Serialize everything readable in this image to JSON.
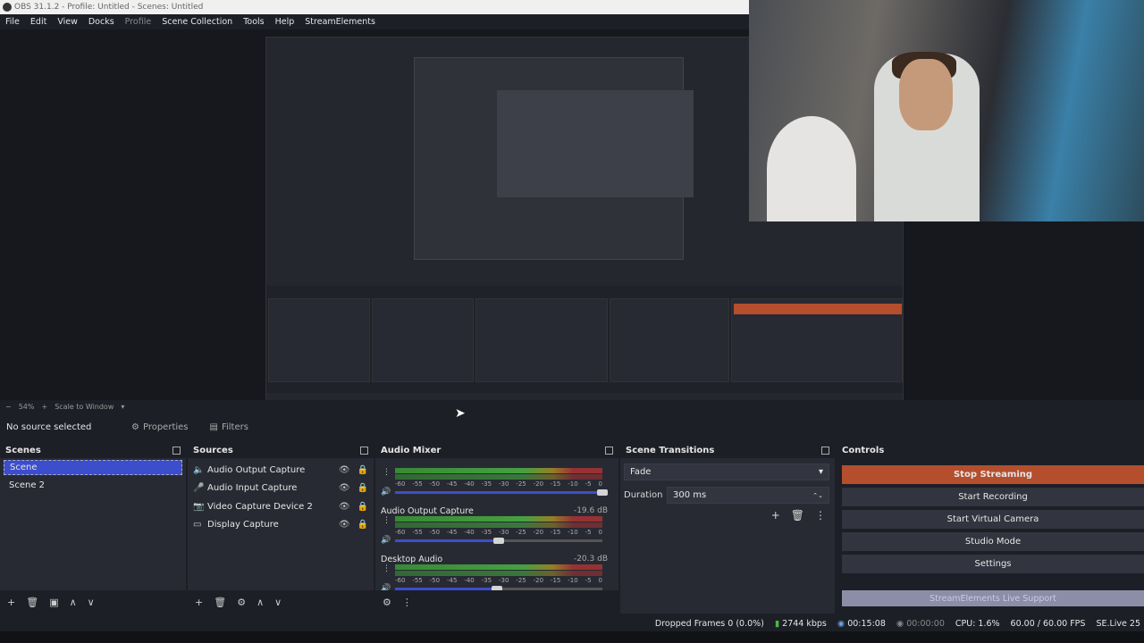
{
  "window": {
    "title": "OBS 31.1.2 - Profile: Untitled - Scenes: Untitled"
  },
  "menu": [
    {
      "label": "File",
      "dim": false
    },
    {
      "label": "Edit",
      "dim": false
    },
    {
      "label": "View",
      "dim": false
    },
    {
      "label": "Docks",
      "dim": false
    },
    {
      "label": "Profile",
      "dim": true
    },
    {
      "label": "Scene Collection",
      "dim": false
    },
    {
      "label": "Tools",
      "dim": false
    },
    {
      "label": "Help",
      "dim": false
    },
    {
      "label": "StreamElements",
      "dim": false
    }
  ],
  "preview_bar": {
    "zoom": "54%",
    "scale_mode": "Scale to Window"
  },
  "source_toolbar": {
    "no_source": "No source selected",
    "properties": "Properties",
    "filters": "Filters"
  },
  "scenes": {
    "title": "Scenes",
    "items": [
      "Scene",
      "Scene 2"
    ],
    "selected": 0
  },
  "sources": {
    "title": "Sources",
    "items": [
      {
        "name": "Audio Output Capture",
        "icon": "speaker-icon"
      },
      {
        "name": "Audio Input Capture",
        "icon": "microphone-icon"
      },
      {
        "name": "Video Capture Device 2",
        "icon": "camera-icon"
      },
      {
        "name": "Display Capture",
        "icon": "monitor-icon"
      }
    ]
  },
  "mixer": {
    "title": "Audio Mixer",
    "ticks": [
      "-60",
      "-55",
      "-50",
      "-45",
      "-40",
      "-35",
      "-30",
      "-25",
      "-20",
      "-15",
      "-10",
      "-5",
      "0"
    ],
    "channels": [
      {
        "name": "",
        "db": "",
        "level": 1.0
      },
      {
        "name": "Audio Output Capture",
        "db": "-19.6 dB",
        "level": 0.5
      },
      {
        "name": "Desktop Audio",
        "db": "-20.3 dB",
        "level": 0.49
      }
    ]
  },
  "transitions": {
    "title": "Scene Transitions",
    "type": "Fade",
    "duration_label": "Duration",
    "duration": "300 ms"
  },
  "controls": {
    "title": "Controls",
    "buttons": [
      "Stop Streaming",
      "Start Recording",
      "Start Virtual Camera",
      "Studio Mode",
      "Settings"
    ],
    "se_support": "StreamElements Live Support"
  },
  "status": {
    "dropped_frames": "Dropped Frames 0 (0.0%)",
    "bitrate": "2744 kbps",
    "stream_time": "00:15:08",
    "rec_time": "00:00:00",
    "cpu": "CPU: 1.6%",
    "fps": "60.00 / 60.00 FPS",
    "se": "SE.Live 25"
  }
}
